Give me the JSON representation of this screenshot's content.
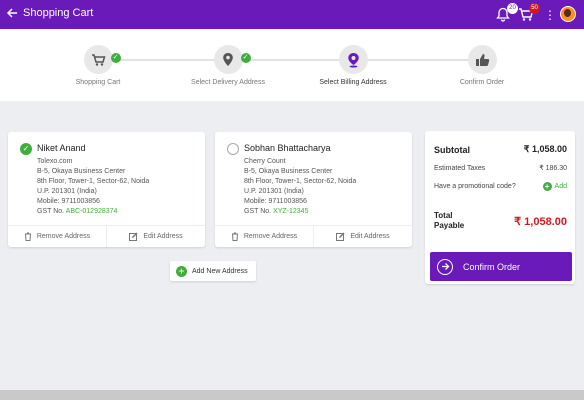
{
  "topbar": {
    "title": "Shopping Cart",
    "notification_count": "20",
    "cart_count": "50",
    "accent": "#6a1ab8"
  },
  "steps": [
    {
      "label": "Shopping Cart",
      "icon": "cart-icon",
      "done": true
    },
    {
      "label": "Select Delivery Address",
      "icon": "location-pin-icon",
      "done": true
    },
    {
      "label": "Select Billing Address",
      "icon": "location-pin-icon",
      "active": true
    },
    {
      "label": "Confirm Order",
      "icon": "thumbs-up-icon"
    }
  ],
  "addresses": [
    {
      "name": "Niket Anand",
      "selected": true,
      "lines": [
        "Tolexo.com",
        "B-5, Okaya Business Center",
        "8th Floor, Tower-1, Sector-62, Noida",
        "U.P. 201301 (India)",
        "Mobile: 9711003856"
      ],
      "gst_label": "GST No.",
      "gst_value": "ABC-012928374",
      "remove_label": "Remove Address",
      "edit_label": "Edit Address"
    },
    {
      "name": "Sobhan Bhattacharya",
      "selected": false,
      "lines": [
        "Cherry Count",
        "B-5, Okaya Business Center",
        "8th Floor, Tower-1, Sector-62, Noida",
        "U.P. 201301 (India)",
        "Mobile: 9711003856"
      ],
      "gst_label": "GST No.",
      "gst_value": "XYZ-12345",
      "remove_label": "Remove Address",
      "edit_label": "Edit Address"
    }
  ],
  "add_address_label": "Add New Address",
  "summary": {
    "subtotal_label": "Subtotal",
    "subtotal_value": "₹ 1,058.00",
    "tax_label": "Estimated Taxes",
    "tax_value": "₹ 186.30",
    "promo_label": "Have a promotional code?",
    "promo_add_label": "Add",
    "total_label": "Total Payable",
    "total_value": "₹ 1,058.00",
    "confirm_label": "Confirm Order"
  },
  "colors": {
    "green": "#3fae3b",
    "red": "#d0181f"
  }
}
